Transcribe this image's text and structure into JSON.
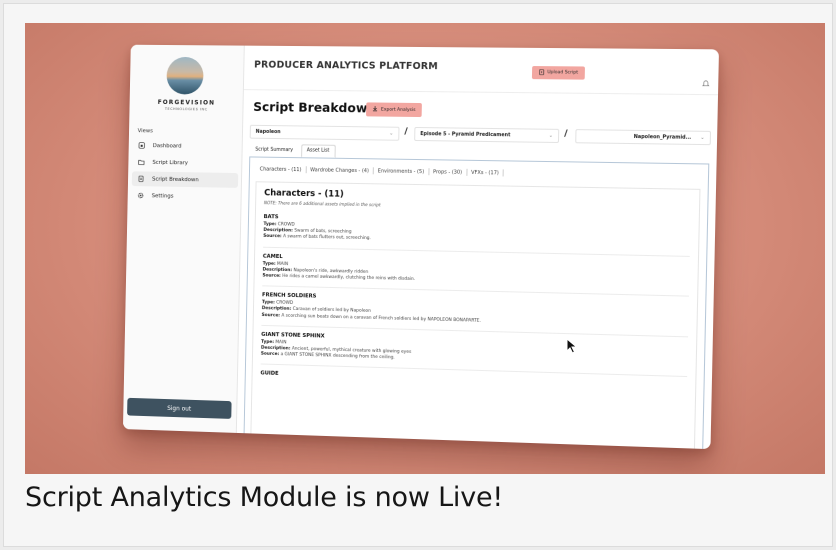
{
  "caption": "Script Analytics Module is now Live!",
  "colors": {
    "accent": "#f2a6a0",
    "signout": "#3e5260",
    "background_gradient": "#d9907e"
  },
  "sidebar": {
    "brand_name": "FORGEVISION",
    "brand_sub": "TECHNOLOGIES INC",
    "views_label": "Views",
    "items": [
      {
        "label": "Dashboard",
        "icon": "home-icon"
      },
      {
        "label": "Script Library",
        "icon": "folder-icon"
      },
      {
        "label": "Script Breakdown",
        "icon": "document-icon",
        "active": true
      },
      {
        "label": "Settings",
        "icon": "gear-icon"
      }
    ],
    "signout_label": "Sign out"
  },
  "header": {
    "platform_title": "PRODUCER ANALYTICS PLATFORM",
    "upload_label": "Upload Script"
  },
  "page": {
    "title": "Script Breakdown",
    "export_label": "Export Analysis"
  },
  "selectors": {
    "project": "Napoleon",
    "episode": "Episode 5 - Pyramid Predicament",
    "script": "Napoleon_Pyramid..."
  },
  "tabs": [
    "Script Summary",
    "Asset List"
  ],
  "subtabs": [
    "Characters - (11)",
    "Wardrobe Changes - (4)",
    "Environments - (5)",
    "Props - (30)",
    "VFXs - (17)"
  ],
  "characters": {
    "title": "Characters - (11)",
    "note": "NOTE: There are 6 additional assets implied in the script",
    "labels": {
      "type": "Type:",
      "description": "Description:",
      "source": "Source:"
    },
    "items": [
      {
        "name": "BATS",
        "type": "CROWD",
        "description": "Swarm of bats, screeching",
        "source": "A swarm of bats flutters out, screeching."
      },
      {
        "name": "CAMEL",
        "type": "MAIN",
        "description": "Napoleon's ride, awkwardly ridden",
        "source": "He rides a camel awkwardly, clutching the reins with disdain."
      },
      {
        "name": "FRENCH SOLDIERS",
        "type": "CROWD",
        "description": "Caravan of soldiers led by Napoleon",
        "source": "A scorching sun beats down on a caravan of French soldiers led by NAPOLEON BONAPARTE."
      },
      {
        "name": "GIANT STONE SPHINX",
        "type": "MAIN",
        "description": "Ancient, powerful, mythical creature with glowing eyes",
        "source": "a GIANT STONE SPHINX descending from the ceiling."
      },
      {
        "name": "GUIDE"
      }
    ]
  }
}
